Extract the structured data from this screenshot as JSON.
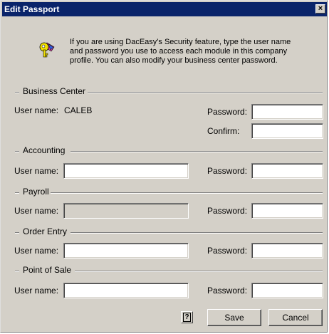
{
  "window": {
    "title": "Edit Passport",
    "close_glyph": "×"
  },
  "intro": {
    "icon": "key-icon",
    "text": "If you are using DacEasy's Security feature, type the user name and password you use to access each module in this company profile. You can also modify your business center password."
  },
  "sections": {
    "business_center": {
      "title": "Business Center",
      "user_label": "User name:",
      "user_value": "CALEB",
      "password_label": "Password:",
      "confirm_label": "Confirm:"
    },
    "accounting": {
      "title": "Accounting",
      "user_label": "User name:",
      "password_label": "Password:"
    },
    "payroll": {
      "title": "Payroll",
      "user_label": "User name:",
      "password_label": "Password:"
    },
    "order_entry": {
      "title": "Order Entry",
      "user_label": "User name:",
      "password_label": "Password:"
    },
    "point_of_sale": {
      "title": "Point of Sale",
      "user_label": "User name:",
      "password_label": "Password:"
    }
  },
  "buttons": {
    "help_glyph": "?",
    "save": "Save",
    "cancel": "Cancel"
  },
  "colors": {
    "titlebar": "#0a246a",
    "dialog_bg": "#d4d0c8"
  }
}
